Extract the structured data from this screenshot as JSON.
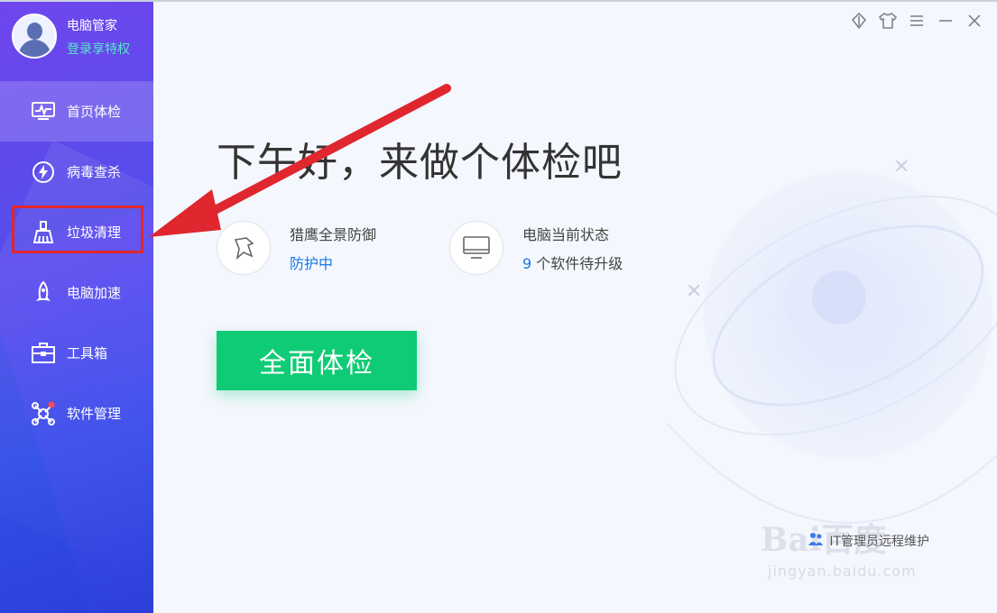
{
  "profile": {
    "app_name": "电脑管家",
    "login_text": "登录享特权",
    "avatar_icon": "user-avatar-icon"
  },
  "nav": {
    "items": [
      {
        "label": "首页体检",
        "icon": "monitor-pulse-icon",
        "active": true
      },
      {
        "label": "病毒查杀",
        "icon": "lightning-shield-icon",
        "active": false
      },
      {
        "label": "垃圾清理",
        "icon": "broom-icon",
        "active": false,
        "highlighted": true
      },
      {
        "label": "电脑加速",
        "icon": "rocket-icon",
        "active": false
      },
      {
        "label": "工具箱",
        "icon": "toolbox-icon",
        "active": false
      },
      {
        "label": "软件管理",
        "icon": "software-puzzle-icon",
        "active": false,
        "badge": true
      }
    ]
  },
  "window_controls": [
    "skin-leaf-icon",
    "tshirt-icon",
    "menu-icon",
    "minimize-icon",
    "close-icon"
  ],
  "main": {
    "greeting": "下午好，来做个体检吧",
    "status": [
      {
        "title": "猎鹰全景防御",
        "value": "防护中",
        "icon": "falcon-icon"
      },
      {
        "title": "电脑当前状态",
        "value_number": "9",
        "value_rest": " 个软件待升级",
        "icon": "monitor-icon"
      }
    ],
    "scan_button": "全面体检",
    "footer_text": "IT管理员远程维护"
  },
  "watermark": {
    "logo": "Bai百度",
    "url": "jingyan.baidu.com"
  },
  "colors": {
    "sidebar_top": "#7046ee",
    "sidebar_bottom": "#2a3ed8",
    "scan_green": "#10cb76",
    "link_blue": "#1a78e8",
    "login_green": "#56e6c7",
    "annotation_red": "#e0262e"
  }
}
